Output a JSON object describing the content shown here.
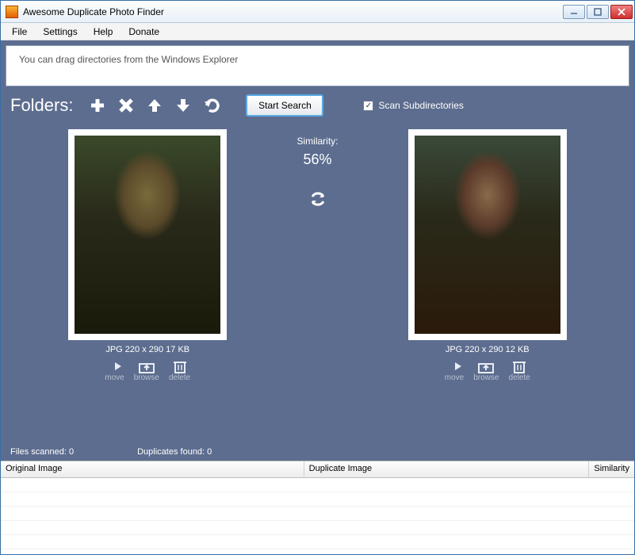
{
  "window": {
    "title": "Awesome Duplicate Photo Finder"
  },
  "menu": {
    "file": "File",
    "settings": "Settings",
    "help": "Help",
    "donate": "Donate"
  },
  "drop_hint": "You can drag directories from the Windows Explorer",
  "toolbar": {
    "folders_label": "Folders:",
    "start_search": "Start Search",
    "scan_subdirs": "Scan Subdirectories",
    "scan_subdirs_checked": "✓"
  },
  "similarity": {
    "label": "Similarity:",
    "value": "56%"
  },
  "left_image": {
    "format": "JPG",
    "dims": "220 x 290",
    "size": "17 KB",
    "meta": "JPG  220 x 290  17 KB"
  },
  "right_image": {
    "format": "JPG",
    "dims": "220 x 290",
    "size": "12 KB",
    "meta": "JPG  220 x 290  12 KB"
  },
  "actions": {
    "move": "move",
    "browse": "browse",
    "delete": "delete"
  },
  "status": {
    "files_scanned": "Files scanned: 0",
    "duplicates_found": "Duplicates found: 0"
  },
  "results": {
    "col_original": "Original Image",
    "col_duplicate": "Duplicate Image",
    "col_similarity": "Similarity"
  }
}
